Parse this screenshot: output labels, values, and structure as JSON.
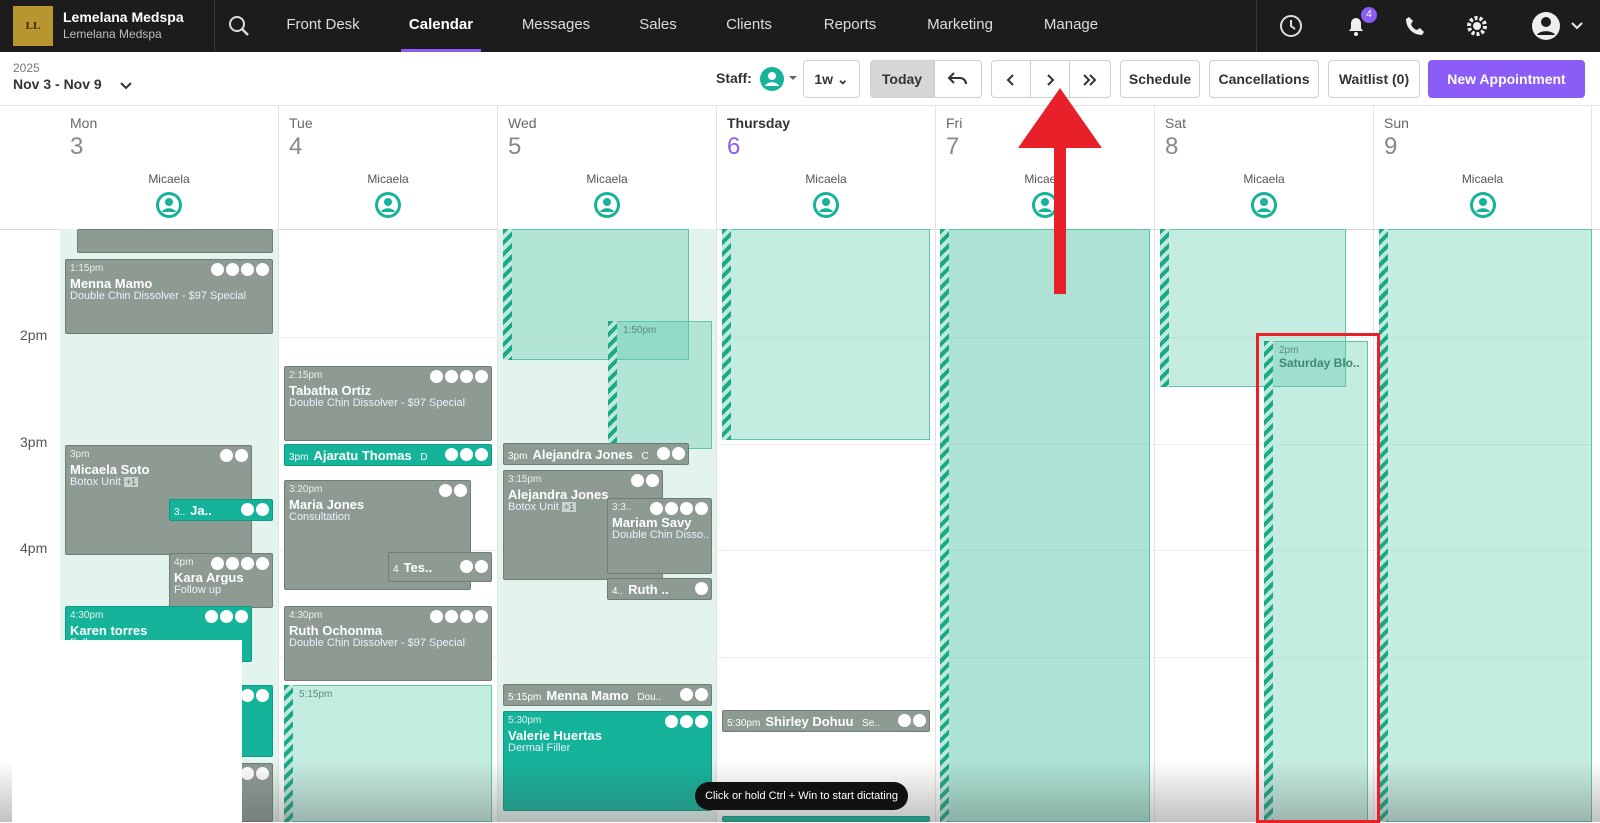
{
  "brand": {
    "logo_text": "LL",
    "name": "Lemelana Medspa",
    "sub": "Lemelana Medspa"
  },
  "nav": [
    "Front Desk",
    "Calendar",
    "Messages",
    "Sales",
    "Clients",
    "Reports",
    "Marketing",
    "Manage"
  ],
  "notifications": "4",
  "toolbar": {
    "year": "2025",
    "range": "Nov 3 - Nov 9",
    "staff_label": "Staff:",
    "view": "1w",
    "today": "Today",
    "schedule": "Schedule",
    "cancellations": "Cancellations",
    "waitlist": "Waitlist (0)",
    "new_appt": "New Appointment"
  },
  "days": [
    {
      "name": "Mon",
      "num": "3",
      "staff": "Micaela"
    },
    {
      "name": "Tue",
      "num": "4",
      "staff": "Micaela"
    },
    {
      "name": "Wed",
      "num": "5",
      "staff": "Micaela"
    },
    {
      "name": "Thursday",
      "num": "6",
      "staff": "Micaela"
    },
    {
      "name": "Fri",
      "num": "7",
      "staff": "Micaela"
    },
    {
      "name": "Sat",
      "num": "8",
      "staff": "Micaela"
    },
    {
      "name": "Sun",
      "num": "9",
      "staff": "Micaela"
    }
  ],
  "times": [
    "2pm",
    "3pm",
    "4pm"
  ],
  "appts": {
    "a1": {
      "time": "1:15pm",
      "name": "Menna Mamo",
      "svc": "Double Chin Dissolver - $97 Special"
    },
    "a2": {
      "time": "2:15pm",
      "name": "Tabatha Ortiz",
      "svc": "Double Chin Dissolver - $97 Special"
    },
    "a3": {
      "time": "3pm",
      "name": "Ajaratu Thomas",
      "svc": "D"
    },
    "a4": {
      "time": "3pm",
      "name": "Micaela Soto",
      "svc": "Botox Unit",
      "extra": "+1"
    },
    "a5": {
      "time": "3..",
      "name": "Ja.."
    },
    "a6": {
      "time": "3:20pm",
      "name": "Maria Jones",
      "svc": "Consultation"
    },
    "a7": {
      "time": "4",
      "name": "Tes.."
    },
    "a8": {
      "time": "4pm",
      "name": "Kara Argus",
      "svc": "Follow up"
    },
    "a9": {
      "time": "4:30pm",
      "name": "Karen torres",
      "svc": "Follow up"
    },
    "a10": {
      "time": "4:30pm",
      "name": "Ruth Ochonma",
      "svc": "Double Chin Dissolver - $97 Special"
    },
    "a11": {
      "time": "3pm",
      "name": "Alejandra Jones",
      "svc": "C"
    },
    "a12": {
      "time": "3:15pm",
      "name": "Alejandra Jones",
      "svc": "Botox Unit",
      "extra": "+1"
    },
    "a13": {
      "time": "3:3..",
      "name": "Mariam Savy",
      "svc": "Double Chin Disso.."
    },
    "a14": {
      "time": "4..",
      "name": "Ruth .."
    },
    "a15": {
      "time": "5:15pm",
      "name": "Menna Mamo",
      "svc": "Dou.."
    },
    "a16": {
      "time": "5:30pm",
      "name": "Valerie Huertas",
      "svc": "Dermal Filler"
    },
    "a17": {
      "time": "5:30pm",
      "name": "Shirley Dohuu",
      "svc": "Se.."
    },
    "a18": {
      "time": "2pm",
      "name": "Saturday Blo.."
    },
    "b1": {
      "time": "1:50pm"
    },
    "b2": {
      "time": "5:15pm"
    }
  },
  "toast": "Click or hold Ctrl + Win to start dictating",
  "colors": {
    "accent": "#8b5cf6",
    "teal": "#14b39a",
    "grey_appt": "#8d9b93",
    "annotation": "#e8202a"
  }
}
